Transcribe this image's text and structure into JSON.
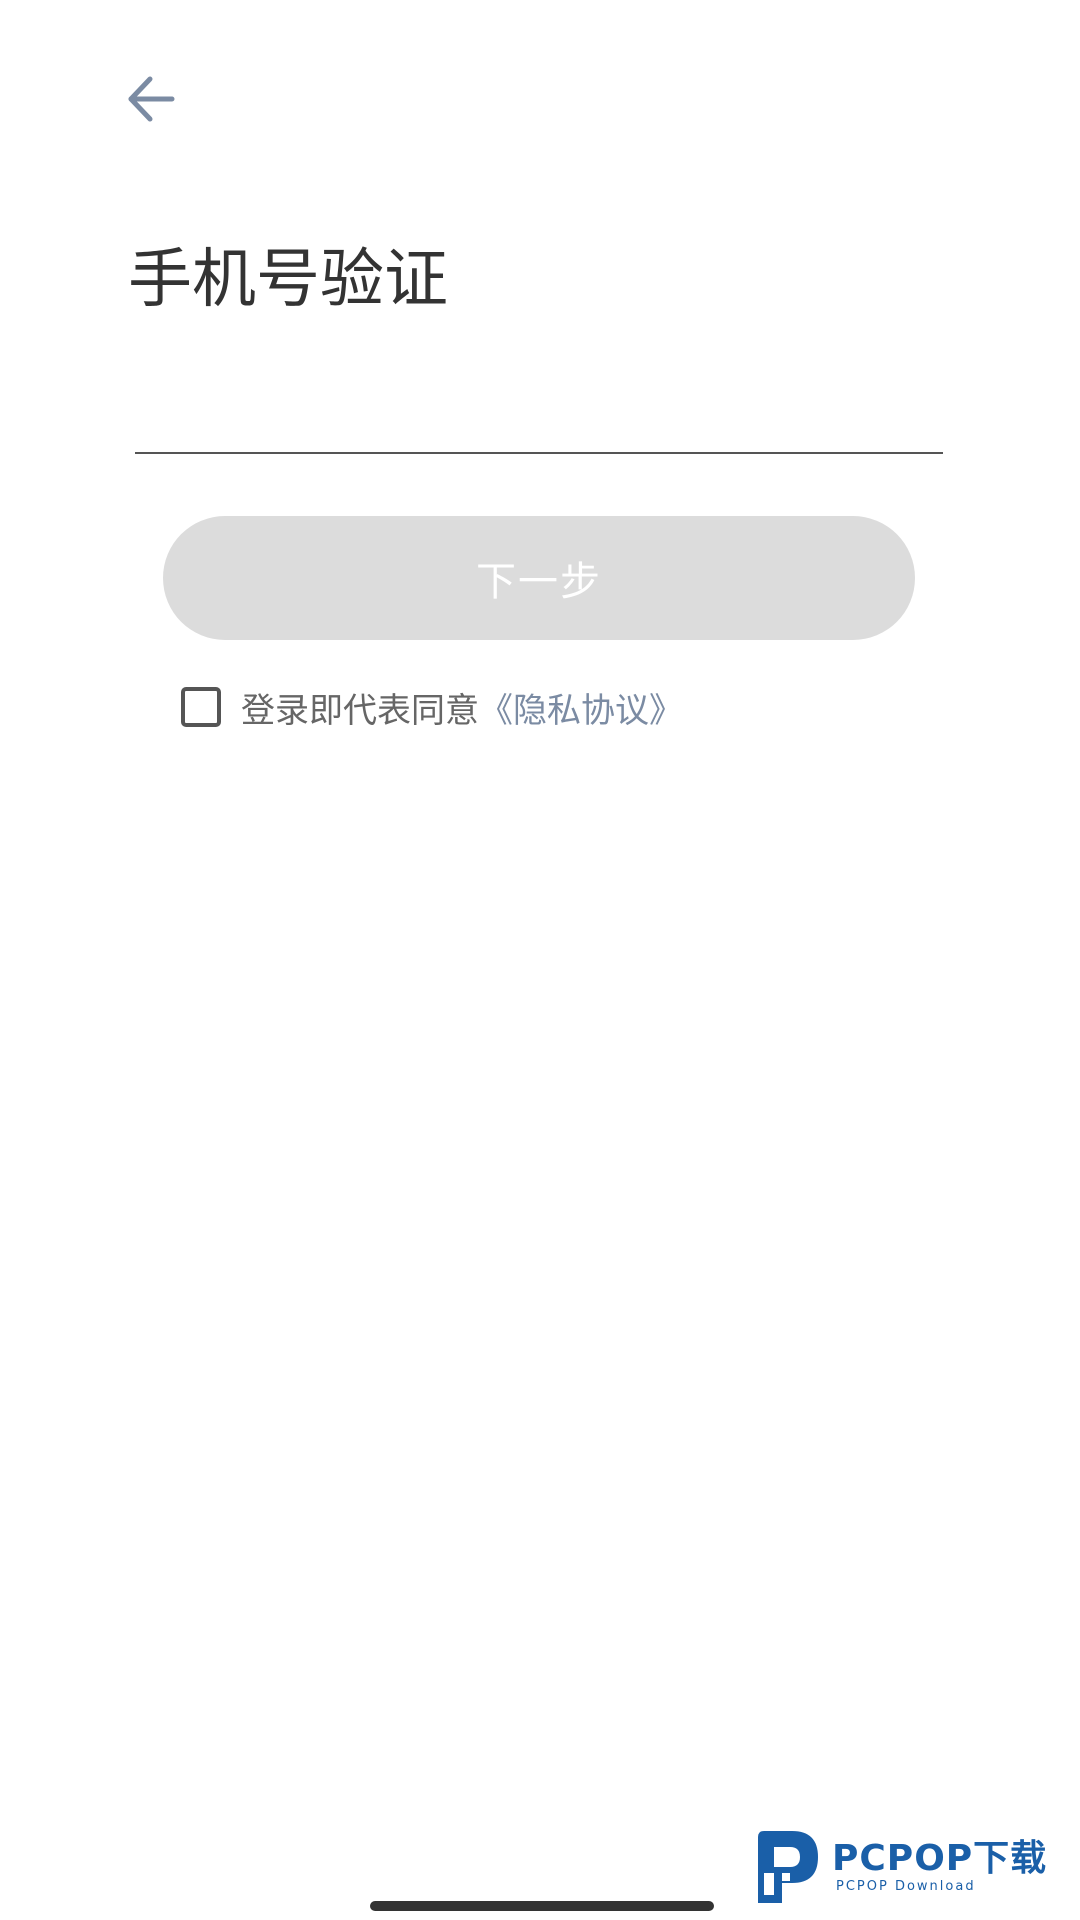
{
  "header": {
    "back_icon": "arrow-left-icon",
    "back_icon_color": "#7b8ba3"
  },
  "page": {
    "title": "手机号验证"
  },
  "phone_input": {
    "value": "",
    "placeholder": ""
  },
  "next_button": {
    "label": "下一步",
    "state": "disabled",
    "background_color": "#dcdcdc"
  },
  "agreement": {
    "checked": false,
    "text": "登录即代表同意",
    "link_label": "《隐私协议》",
    "link_color": "#7b8ba3"
  },
  "watermark": {
    "brand": "PCPOP下载",
    "subtitle": "PCPOP Download",
    "color": "#1a5fa8"
  }
}
